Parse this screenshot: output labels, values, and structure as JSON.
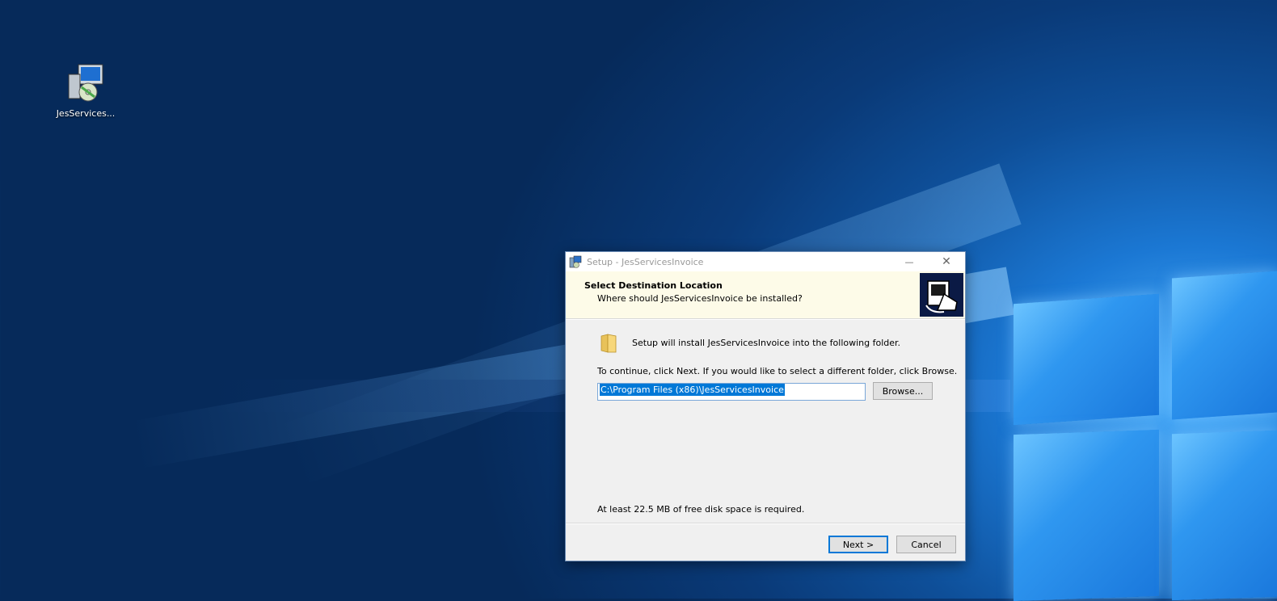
{
  "desktop": {
    "icon_label": "JesServices...",
    "icon_name": "installer-icon"
  },
  "dialog": {
    "window_title": "Setup - JesServicesInvoice",
    "minimize_glyph": "—",
    "close_glyph": "✕",
    "header_title": "Select Destination Location",
    "header_subtitle": "Where should JesServicesInvoice be installed?",
    "install_text": "Setup will install JesServicesInvoice into the following folder.",
    "continue_text": "To continue, click Next. If you would like to select a different folder, click Browse.",
    "path_value": "C:\\Program Files (x86)\\JesServicesInvoice",
    "browse_label": "Browse...",
    "disk_space_text": "At least 22.5 MB of free disk space is required.",
    "next_label": "Next >",
    "cancel_label": "Cancel"
  },
  "colors": {
    "accent": "#0078d7",
    "header_bg": "#fdfbe8"
  }
}
